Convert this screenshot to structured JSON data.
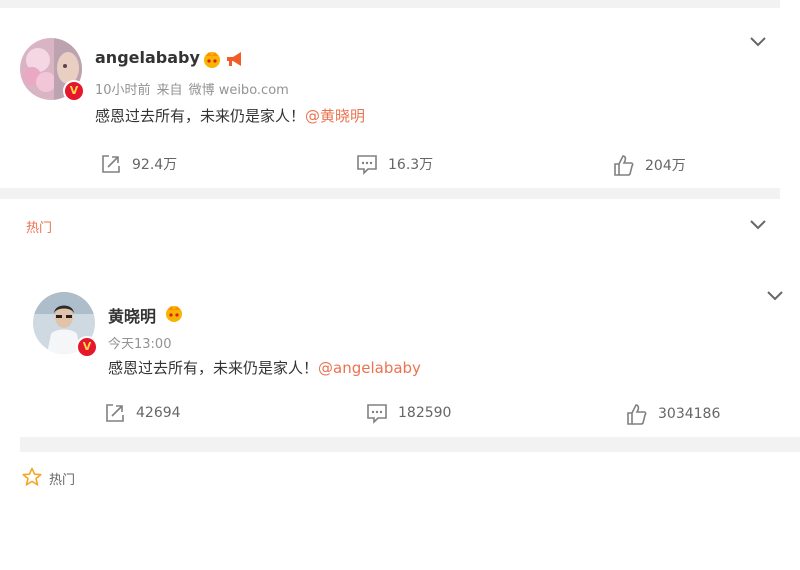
{
  "post1": {
    "username": "angelababy",
    "time": "10小时前",
    "source_prefix": "来自",
    "source": "微博 weibo.com",
    "content": "感恩过去所有，未来仍是家人！",
    "mention": "@黄晓明",
    "repost_count": "92.4万",
    "comment_count": "16.3万",
    "like_count": "204万",
    "verified_badge": "V"
  },
  "section1": {
    "label": "热门"
  },
  "post2": {
    "username": "黄晓明",
    "time": "今天13:00",
    "content": "感恩过去所有，未来仍是家人！",
    "mention": "@angelababy",
    "repost_count": "42694",
    "comment_count": "182590",
    "like_count": "3034186",
    "verified_badge": "V"
  },
  "section2": {
    "label": "热门"
  },
  "icons": {
    "crown": "crown-icon",
    "megaphone": "megaphone-icon",
    "repost": "repost-icon",
    "comment": "comment-icon",
    "like": "like-icon",
    "chevron": "chevron-down-icon",
    "star": "star-icon"
  },
  "colors": {
    "accent": "#eb7350",
    "verified": "#e6162d",
    "separator": "#f2f2f2",
    "muted": "#939393"
  }
}
